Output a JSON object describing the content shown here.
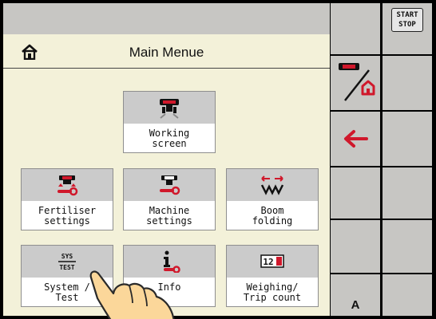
{
  "header": {
    "title": "Main Menue"
  },
  "tiles": [
    {
      "label": "Working\nscreen",
      "icon": "working-screen-icon"
    },
    {
      "label": "Fertiliser\nsettings",
      "icon": "fertiliser-settings-icon"
    },
    {
      "label": "Machine\nsettings",
      "icon": "machine-settings-icon"
    },
    {
      "label": "Boom\nfolding",
      "icon": "boom-folding-icon"
    },
    {
      "label": "System /\nTest",
      "icon": "system-test-icon",
      "icon_text_top": "SYS",
      "icon_text_bottom": "TEST"
    },
    {
      "label": "Info",
      "icon": "info-icon"
    },
    {
      "label": "Weighing/\nTrip count",
      "icon": "weighing-icon",
      "icon_text": "12"
    }
  ],
  "softkeys": {
    "start_stop_top": "START",
    "start_stop_bottom": "STOP",
    "a_label": "A"
  },
  "colors": {
    "panel_background": "#f3f1d9",
    "softkey_grey": "#c7c6c3",
    "accent_red": "#d0182b"
  }
}
